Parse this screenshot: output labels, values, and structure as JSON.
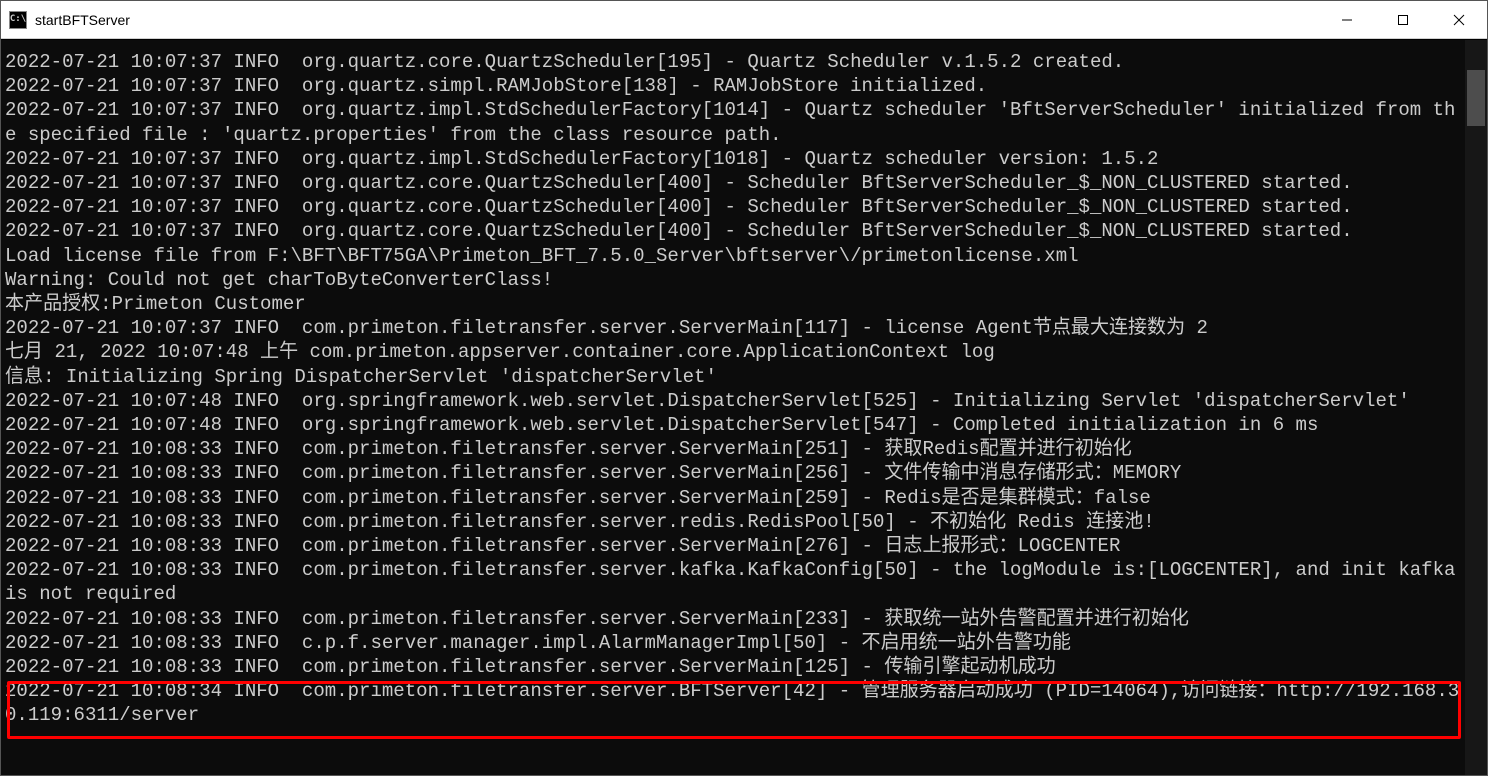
{
  "window": {
    "title": "startBFTServer",
    "icon_label": "C:\\"
  },
  "controls": {
    "minimize": "minimize",
    "maximize": "maximize",
    "close": "close"
  },
  "log_lines": [
    "2022-07-21 10:07:37 INFO  org.quartz.core.QuartzScheduler[195] - Quartz Scheduler v.1.5.2 created.",
    "2022-07-21 10:07:37 INFO  org.quartz.simpl.RAMJobStore[138] - RAMJobStore initialized.",
    "2022-07-21 10:07:37 INFO  org.quartz.impl.StdSchedulerFactory[1014] - Quartz scheduler 'BftServerScheduler' initialized from the specified file : 'quartz.properties' from the class resource path.",
    "2022-07-21 10:07:37 INFO  org.quartz.impl.StdSchedulerFactory[1018] - Quartz scheduler version: 1.5.2",
    "2022-07-21 10:07:37 INFO  org.quartz.core.QuartzScheduler[400] - Scheduler BftServerScheduler_$_NON_CLUSTERED started.",
    "2022-07-21 10:07:37 INFO  org.quartz.core.QuartzScheduler[400] - Scheduler BftServerScheduler_$_NON_CLUSTERED started.",
    "2022-07-21 10:07:37 INFO  org.quartz.core.QuartzScheduler[400] - Scheduler BftServerScheduler_$_NON_CLUSTERED started.",
    "Load license file from F:\\BFT\\BFT75GA\\Primeton_BFT_7.5.0_Server\\bftserver\\/primetonlicense.xml",
    "Warning: Could not get charToByteConverterClass!",
    "本产品授权:Primeton Customer",
    "2022-07-21 10:07:37 INFO  com.primeton.filetransfer.server.ServerMain[117] - license Agent节点最大连接数为 2",
    "七月 21, 2022 10:07:48 上午 com.primeton.appserver.container.core.ApplicationContext log",
    "信息: Initializing Spring DispatcherServlet 'dispatcherServlet'",
    "2022-07-21 10:07:48 INFO  org.springframework.web.servlet.DispatcherServlet[525] - Initializing Servlet 'dispatcherServlet'",
    "2022-07-21 10:07:48 INFO  org.springframework.web.servlet.DispatcherServlet[547] - Completed initialization in 6 ms",
    "2022-07-21 10:08:33 INFO  com.primeton.filetransfer.server.ServerMain[251] - 获取Redis配置并进行初始化",
    "2022-07-21 10:08:33 INFO  com.primeton.filetransfer.server.ServerMain[256] - 文件传输中消息存储形式：MEMORY",
    "2022-07-21 10:08:33 INFO  com.primeton.filetransfer.server.ServerMain[259] - Redis是否是集群模式：false",
    "2022-07-21 10:08:33 INFO  com.primeton.filetransfer.server.redis.RedisPool[50] - 不初始化 Redis 连接池!",
    "2022-07-21 10:08:33 INFO  com.primeton.filetransfer.server.ServerMain[276] - 日志上报形式：LOGCENTER",
    "2022-07-21 10:08:33 INFO  com.primeton.filetransfer.server.kafka.KafkaConfig[50] - the logModule is:[LOGCENTER], and init kafka is not required",
    "2022-07-21 10:08:33 INFO  com.primeton.filetransfer.server.ServerMain[233] - 获取统一站外告警配置并进行初始化",
    "2022-07-21 10:08:33 INFO  c.p.f.server.manager.impl.AlarmManagerImpl[50] - 不启用统一站外告警功能",
    "2022-07-21 10:08:33 INFO  com.primeton.filetransfer.server.ServerMain[125] - 传输引擎起动机成功",
    "2022-07-21 10:08:34 INFO  com.primeton.filetransfer.server.BFTServer[42] - 管理服务器启动成功 (PID=14064),访问链接：http://192.168.30.119:6311/server"
  ]
}
